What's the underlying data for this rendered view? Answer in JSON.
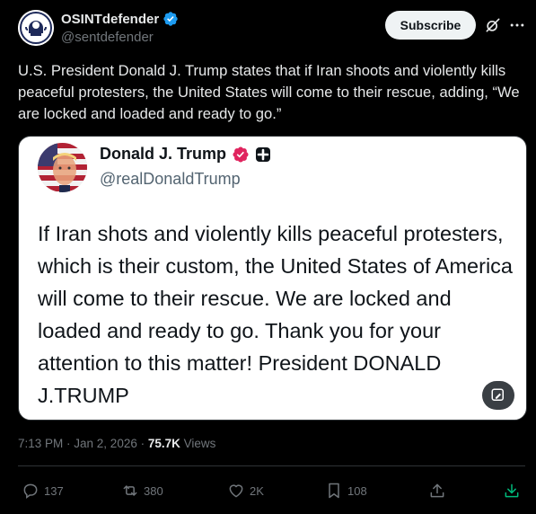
{
  "author": {
    "display_name": "OSINTdefender",
    "handle": "@sentdefender"
  },
  "header": {
    "subscribe_label": "Subscribe",
    "icons": [
      "grok-icon",
      "more-icon"
    ]
  },
  "tweet": {
    "text": "U.S. President Donald J. Trump states that if Iran shoots and violently kills peaceful protesters, the United States will come to their rescue, adding, “We are locked and loaded and ready to go.”"
  },
  "embedded": {
    "display_name": "Donald J. Trump",
    "handle": "@realDonaldTrump",
    "text": "If Iran shots and violently kills peaceful protesters, which is their custom, the United States of America will come to their rescue. We are locked and loaded and ready to go. Thank you for your attention to this matter! President DONALD J.TRUMP"
  },
  "meta": {
    "time": "7:13 PM",
    "sep1": " · ",
    "date": "Jan 2, 2026",
    "sep2": " · ",
    "views_count": "75.7K",
    "views_label": " Views"
  },
  "actions": {
    "replies": "137",
    "reposts": "380",
    "likes": "2K",
    "bookmarks": "108"
  },
  "colors": {
    "background": "#000000",
    "text": "#e7e9ea",
    "secondary": "#71767b",
    "verified_blue": "#1d9bf0",
    "verified_gold": "#e0245e",
    "accent_green": "#00ba7c"
  }
}
